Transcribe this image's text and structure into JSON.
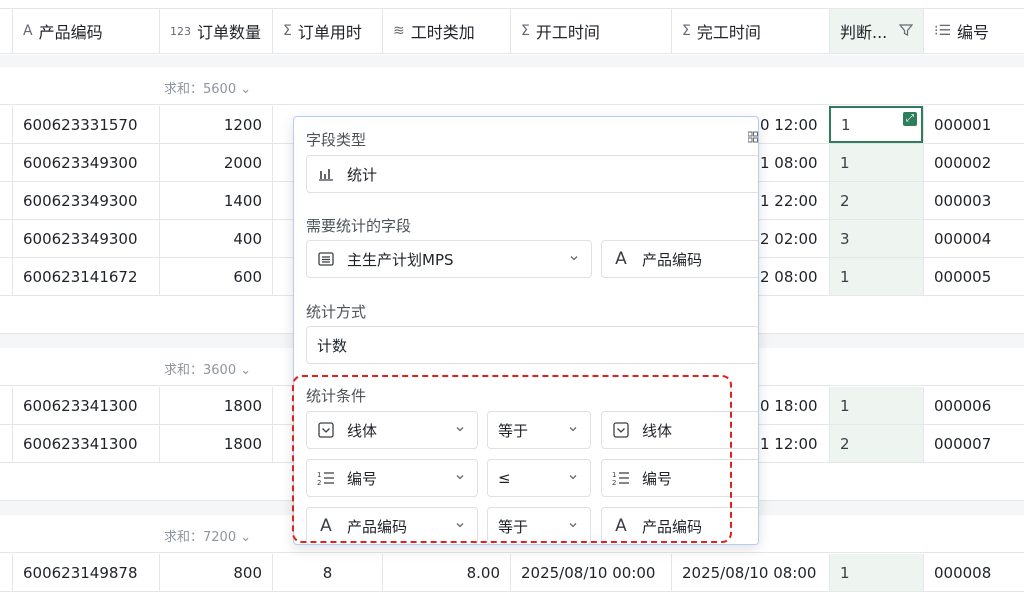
{
  "columns": [
    {
      "icon": "text-icon",
      "glyph": "A",
      "label": "产品编码"
    },
    {
      "icon": "number-icon",
      "glyph": "123",
      "label": "订单数量"
    },
    {
      "icon": "sum-icon",
      "glyph": "Σ",
      "label": "订单用时"
    },
    {
      "icon": "layers-icon",
      "glyph": "≋",
      "label": "工时类加"
    },
    {
      "icon": "sum-icon",
      "glyph": "Σ",
      "label": "开工时间"
    },
    {
      "icon": "sum-icon",
      "glyph": "Σ",
      "label": "完工时间"
    },
    {
      "icon": "text-icon",
      "glyph": "",
      "label": "判断..."
    },
    {
      "icon": "autonumber-icon",
      "glyph": "⁝☰",
      "label": "编号"
    }
  ],
  "groups": [
    {
      "sum": "求和：5600"
    },
    {
      "sum": "求和：3600"
    },
    {
      "sum": "求和：7200"
    }
  ],
  "rows": [
    {
      "code": "600623331570",
      "qty": "1200",
      "finish_partial": "0 12:00",
      "judge": "1",
      "no": "000001"
    },
    {
      "code": "600623349300",
      "qty": "2000",
      "finish_partial": "1 08:00",
      "judge": "1",
      "no": "000002"
    },
    {
      "code": "600623349300",
      "qty": "1400",
      "finish_partial": "1 22:00",
      "judge": "2",
      "no": "000003"
    },
    {
      "code": "600623349300",
      "qty": "400",
      "finish_partial": "2 02:00",
      "judge": "3",
      "no": "000004"
    },
    {
      "code": "600623141672",
      "qty": "600",
      "finish_partial": "2 08:00",
      "judge": "1",
      "no": "000005"
    },
    {
      "code": "600623341300",
      "qty": "1800",
      "finish_partial": "0 18:00",
      "judge": "1",
      "no": "000006"
    },
    {
      "code": "600623341300",
      "qty": "1800",
      "finish_partial": "1 12:00",
      "judge": "2",
      "no": "000007"
    }
  ],
  "last_row": {
    "code": "600623149878",
    "qty": "800",
    "time": "8",
    "hours": "8.00",
    "start": "2025/08/10 00:00",
    "finish": "2025/08/10 08:00",
    "judge": "1",
    "no": "000008"
  },
  "panel": {
    "field_type_label": "字段类型",
    "field_type_value": "统计",
    "stat_field_label": "需要统计的字段",
    "stat_table": "主生产计划MPS",
    "stat_field": "产品编码",
    "method_label": "统计方式",
    "method_value": "计数",
    "conditions_label": "统计条件",
    "conditions": [
      {
        "field": "线体",
        "field_icon": "checkbox-icon",
        "op": "等于",
        "value": "线体",
        "value_icon": "checkbox-icon"
      },
      {
        "field": "编号",
        "field_icon": "autonumber-icon",
        "op": "≤",
        "value": "编号",
        "value_icon": "autonumber-icon"
      },
      {
        "field": "产品编码",
        "field_icon": "text-icon",
        "op": "等于",
        "value": "产品编码",
        "value_icon": "text-icon"
      }
    ]
  },
  "colors": {
    "accent": "#2e7d5b",
    "highlight": "#e0211d",
    "panel_border": "#b6ccf4"
  }
}
